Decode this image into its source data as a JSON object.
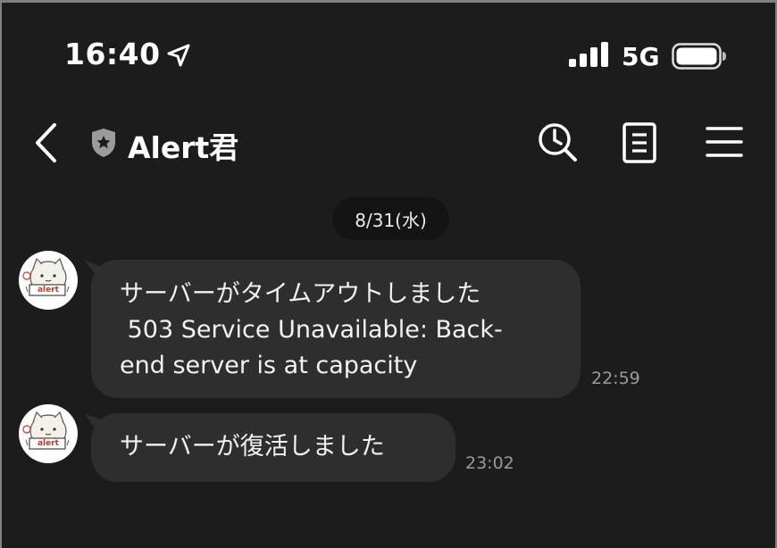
{
  "status_bar": {
    "time": "16:40",
    "network": "5G",
    "icons": [
      "location-arrow-icon",
      "signal-bars-icon",
      "battery-icon"
    ]
  },
  "header": {
    "title": "Alert君",
    "icons": [
      "back-chevron-icon",
      "shield-star-icon",
      "search-clock-icon",
      "note-icon",
      "menu-icon"
    ]
  },
  "date_separator": "8/31(水)",
  "messages": [
    {
      "lines": [
        "サーバーがタイムアウトしました",
        " 503 Service Unavailable: Back-",
        "end server is at capacity"
      ],
      "time": "22:59",
      "avatar_text": "alert"
    },
    {
      "lines": [
        "サーバーが復活しました"
      ],
      "time": "23:02",
      "avatar_text": "alert"
    }
  ],
  "colors": {
    "background": "#1c1c1c",
    "bubble": "#2e2e2e",
    "timestamp": "#9a9a9a"
  }
}
